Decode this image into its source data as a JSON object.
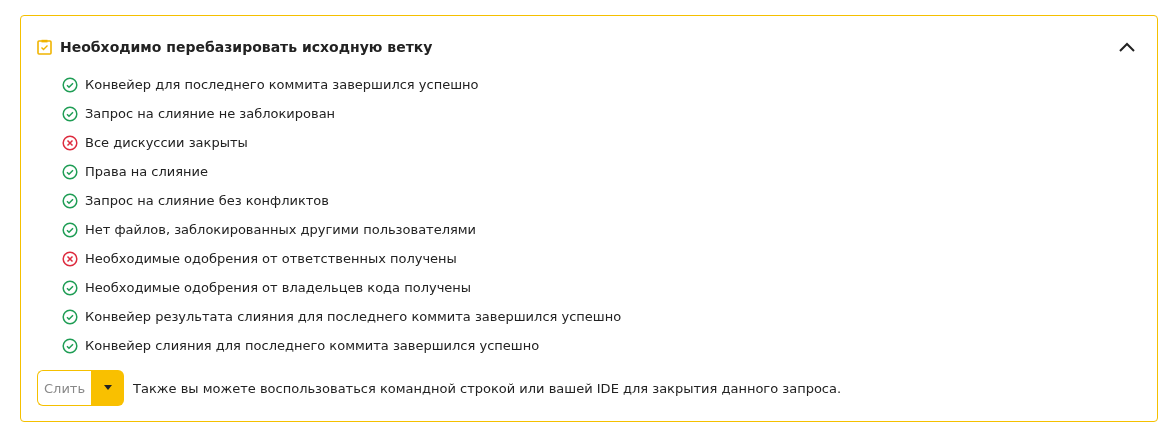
{
  "panel": {
    "title": "Необходимо перебазировать исходную ветку",
    "expanded": true
  },
  "checks": [
    {
      "label": "Конвейер для последнего коммита завершился успешно",
      "passed": true
    },
    {
      "label": "Запрос на слияние не заблокирован",
      "passed": true
    },
    {
      "label": "Все дискуссии закрыты",
      "passed": false
    },
    {
      "label": "Права на слияние",
      "passed": true
    },
    {
      "label": "Запрос на слияние без конфликтов",
      "passed": true
    },
    {
      "label": "Нет файлов, заблокированных другими пользователями",
      "passed": true
    },
    {
      "label": "Необходимые одобрения от ответственных получены",
      "passed": false
    },
    {
      "label": "Необходимые одобрения от владельцев кода получены",
      "passed": true
    },
    {
      "label": "Конвейер результата слияния для последнего коммита завершился успешно",
      "passed": true
    },
    {
      "label": "Конвейер слияния для последнего коммита завершился успешно",
      "passed": true
    }
  ],
  "merge_button": {
    "label": "Слить",
    "disabled": true
  },
  "hint": "Также вы можете воспользоваться командной строкой или вашей IDE для закрытия данного запроса."
}
